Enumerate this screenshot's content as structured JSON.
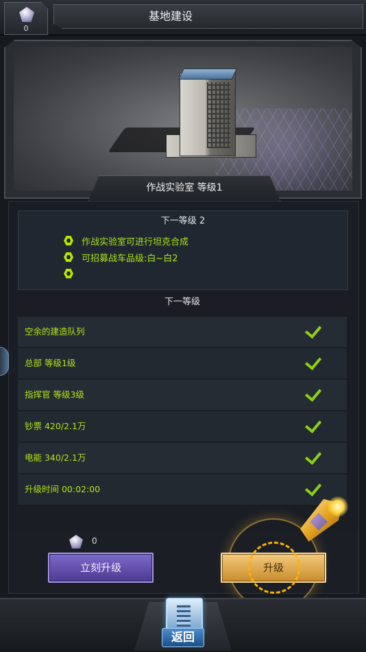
{
  "header": {
    "gem_count": "0",
    "title": "基地建设"
  },
  "building": {
    "caption": "作战实验室 等级1"
  },
  "next_level": {
    "title": "下一等级 2",
    "benefits": [
      "作战实验室可进行坦克合成",
      "可招募战车品级:白~白2",
      ""
    ]
  },
  "requirements": {
    "title": "下一等级",
    "items": [
      {
        "label": "空余的建造队列",
        "met": true
      },
      {
        "label": "总部 等级1级",
        "met": true
      },
      {
        "label": "指挥官 等级3级",
        "met": true
      },
      {
        "label": "钞票 420/2.1万",
        "met": true
      },
      {
        "label": "电能 340/2.1万",
        "met": true
      },
      {
        "label": "升级时间 00:02:00",
        "met": true
      }
    ]
  },
  "actions": {
    "instant_cost": "0",
    "instant_label": "立刻升级",
    "upgrade_label": "升级"
  },
  "footer": {
    "back_label": "返回"
  },
  "colors": {
    "accent_green": "#a8e617",
    "instant_purple": "#6a58b8",
    "upgrade_gold": "#e2a94a"
  }
}
